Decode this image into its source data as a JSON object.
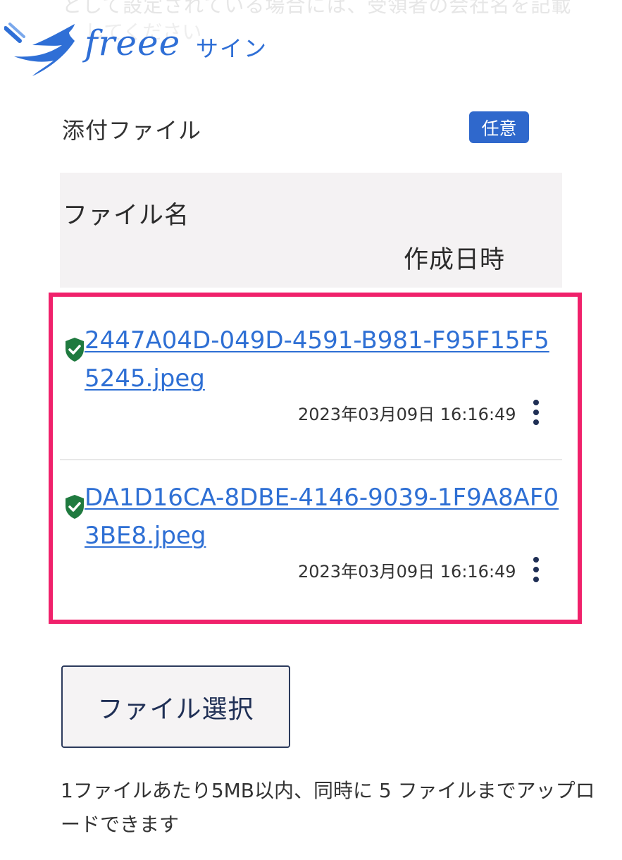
{
  "background_text": {
    "line1": "として設定されている場合には、受領者の会社名を記載",
    "line2": "してください"
  },
  "logo": {
    "brand": "freee",
    "product": "サイン",
    "color": "#2f6fd6"
  },
  "attachments": {
    "label": "添付ファイル",
    "badge": "任意",
    "badge_color": "#2f68cc"
  },
  "table": {
    "headers": {
      "file_name": "ファイル名",
      "created_at": "作成日時"
    },
    "rows": [
      {
        "file_name": "2447A04D-049D-4591-B981-F95F15F55245.jpeg",
        "created_at": "2023年03月09日 16:16:49",
        "verified_icon": "shield-check-icon",
        "menu_icon": "more-vertical-icon"
      },
      {
        "file_name": "DA1D16CA-8DBE-4146-9039-1F9A8AF03BE8.jpeg",
        "created_at": "2023年03月09日 16:16:49",
        "verified_icon": "shield-check-icon",
        "menu_icon": "more-vertical-icon"
      }
    ],
    "highlight_color": "#f0216b"
  },
  "upload": {
    "button_label": "ファイル選択",
    "note": "1ファイルあたり5MB以内、同時に 5 ファイルまでアップロードできます"
  }
}
